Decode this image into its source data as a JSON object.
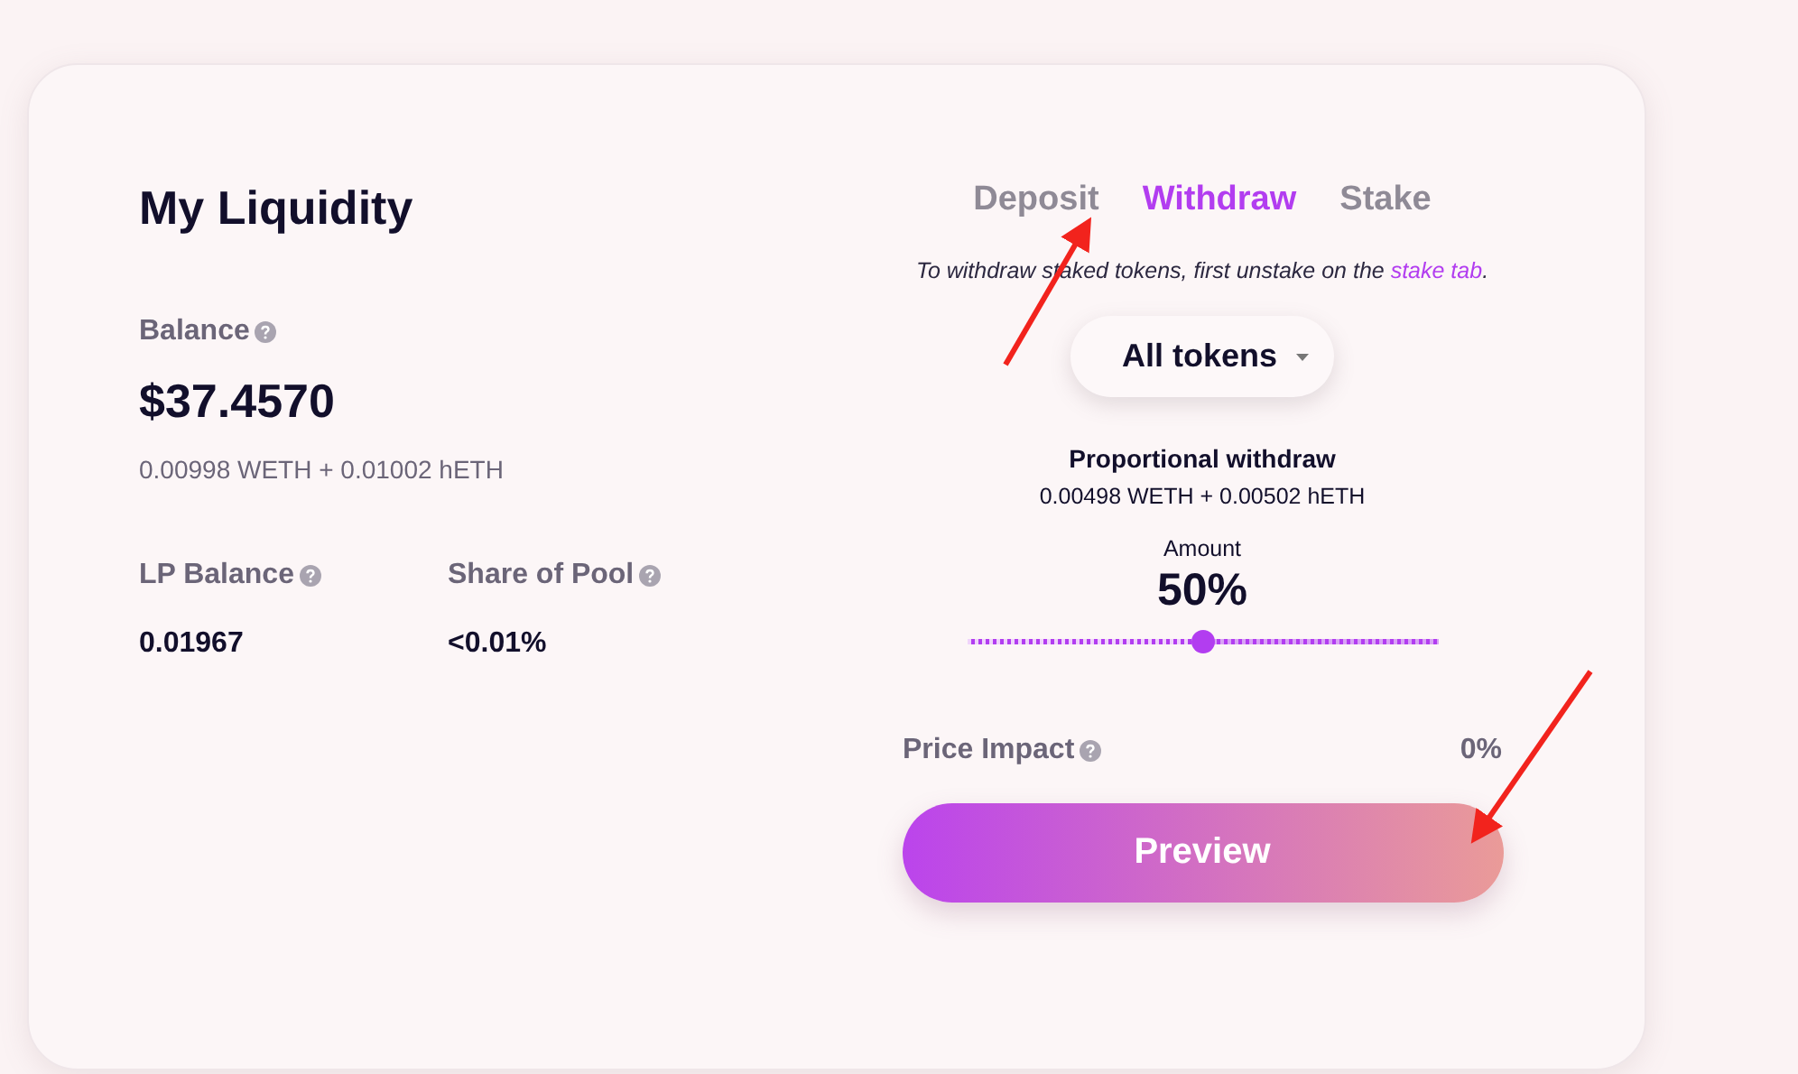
{
  "title": "My Liquidity",
  "balance": {
    "label": "Balance",
    "value": "$37.4570",
    "breakdown": "0.00998 WETH + 0.01002 hETH"
  },
  "stats": [
    {
      "label": "LP Balance",
      "value": "0.01967"
    },
    {
      "label": "Share of Pool",
      "value": "<0.01%"
    }
  ],
  "tabs": [
    {
      "label": "Deposit",
      "selected": false
    },
    {
      "label": "Withdraw",
      "selected": true
    },
    {
      "label": "Stake",
      "selected": false
    }
  ],
  "notice": {
    "text": "To withdraw staked tokens, first unstake on the",
    "link": "stake tab",
    "end": "."
  },
  "token_select": {
    "value": "All tokens"
  },
  "withdraw": {
    "title": "Proportional withdraw",
    "amounts": "0.00498 WETH + 0.00502 hETH"
  },
  "amount": {
    "label": "Amount",
    "value": "50%",
    "level": 0.5
  },
  "price_impact": {
    "label": "Price Impact",
    "value": "0%"
  },
  "preview_button": "Preview"
}
